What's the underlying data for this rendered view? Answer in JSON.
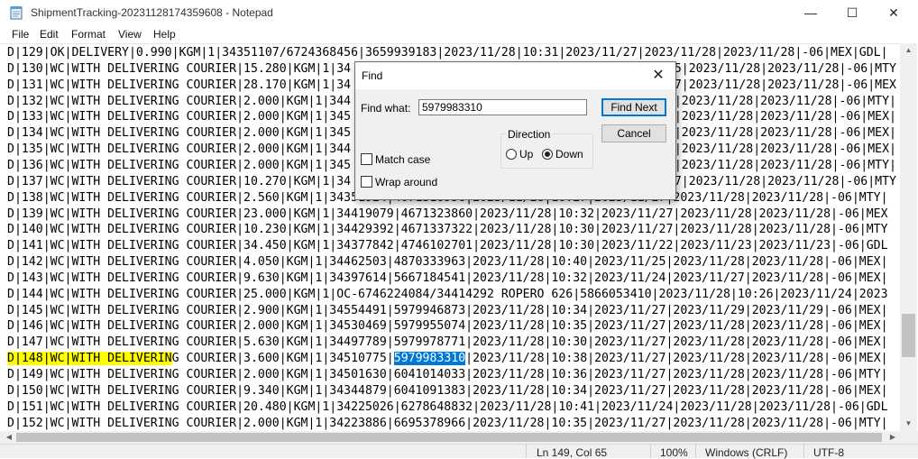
{
  "window": {
    "title": "ShipmentTracking-20231128174359608 - Notepad",
    "minimize_glyph": "—",
    "maximize_glyph": "☐",
    "close_glyph": "✕"
  },
  "menu": [
    "File",
    "Edit",
    "Format",
    "View",
    "Help"
  ],
  "colors": {
    "highlight": "#ffff00",
    "selection": "#0078d7",
    "accent": "#0078d7"
  },
  "editor": {
    "lines": [
      "D|129|OK|DELIVERY|0.990|KGM|1|34351107/6724368456|3659939183|2023/11/28|10:31|2023/11/27|2023/11/28|2023/11/28|-06|MEX|GDL|",
      "D|130|WC|WITH DELIVERING COURIER|15.280|KGM|1|34",
      "D|131|WC|WITH DELIVERING COURIER|28.170|KGM|1|34",
      "D|132|WC|WITH DELIVERING COURIER|2.000|KGM|1|344",
      "D|133|WC|WITH DELIVERING COURIER|2.000|KGM|1|345",
      "D|134|WC|WITH DELIVERING COURIER|2.000|KGM|1|345",
      "D|135|WC|WITH DELIVERING COURIER|2.000|KGM|1|344",
      "D|136|WC|WITH DELIVERING COURIER|2.000|KGM|1|345",
      "D|137|WC|WITH DELIVERING COURIER|10.270|KGM|1|34",
      "D|138|WC|WITH DELIVERING COURIER|2.560|KGM|1|34351924|4671318956|2023/11/28|10:27|2023/11/27|2023/11/28|2023/11/28|-06|MTY|",
      "D|139|WC|WITH DELIVERING COURIER|23.000|KGM|1|34419079|4671323860|2023/11/28|10:32|2023/11/27|2023/11/28|2023/11/28|-06|MEX",
      "D|140|WC|WITH DELIVERING COURIER|10.230|KGM|1|34429392|4671337322|2023/11/28|10:30|2023/11/27|2023/11/28|2023/11/28|-06|MTY",
      "D|141|WC|WITH DELIVERING COURIER|34.450|KGM|1|34377842|4746102701|2023/11/28|10:30|2023/11/22|2023/11/23|2023/11/23|-06|GDL",
      "D|142|WC|WITH DELIVERING COURIER|4.050|KGM|1|34462503|4870333963|2023/11/28|10:40|2023/11/25|2023/11/28|2023/11/28|-06|MEX|",
      "D|143|WC|WITH DELIVERING COURIER|9.630|KGM|1|34397614|5667184541|2023/11/28|10:32|2023/11/24|2023/11/27|2023/11/28|-06|MEX|",
      "D|144|WC|WITH DELIVERING COURIER|25.000|KGM|1|OC-6746224084/34414292 ROPERO 626|5866053410|2023/11/28|10:26|2023/11/24|2023",
      "D|145|WC|WITH DELIVERING COURIER|2.900|KGM|1|34554491|5979946873|2023/11/28|10:34|2023/11/27|2023/11/29|2023/11/29|-06|MEX|",
      "D|146|WC|WITH DELIVERING COURIER|2.000|KGM|1|34530469|5979955074|2023/11/28|10:35|2023/11/27|2023/11/28|2023/11/28|-06|MEX|",
      "D|147|WC|WITH DELIVERING COURIER|5.630|KGM|1|34497789|5979978771|2023/11/28|10:30|2023/11/27|2023/11/28|2023/11/28|-06|MEX|",
      "D|148|WC|WITH DELIVERING COURIER|3.600|KGM|1|34510775|5979983310|2023/11/28|10:38|2023/11/27|2023/11/28|2023/11/28|-06|MEX|",
      "D|149|WC|WITH DELIVERING COURIER|2.000|KGM|1|34501630|6041014033|2023/11/28|10:36|2023/11/27|2023/11/28|2023/11/28|-06|MTY|",
      "D|150|WC|WITH DELIVERING COURIER|9.340|KGM|1|34344879|6041091383|2023/11/28|10:34|2023/11/27|2023/11/28|2023/11/28|-06|MEX|",
      "D|151|WC|WITH DELIVERING COURIER|20.480|KGM|1|34225026|6278648832|2023/11/28|10:41|2023/11/24|2023/11/28|2023/11/28|-06|GDL",
      "D|152|WC|WITH DELIVERING COURIER|2.000|KGM|1|34223886|6695378966|2023/11/28|10:35|2023/11/27|2023/11/28|2023/11/28|-06|MTY|"
    ],
    "right_fragments": [
      "",
      "5|2023/11/28|2023/11/28|-06|MTY",
      "7|2023/11/28|2023/11/28|-06|MEX",
      "|2023/11/28|2023/11/28|-06|MTY|",
      "|2023/11/28|2023/11/28|-06|MEX|",
      "|2023/11/28|2023/11/28|-06|MEX|",
      "|2023/11/28|2023/11/28|-06|MEX|",
      "|2023/11/28|2023/11/28|-06|MTY|",
      "7|2023/11/28|2023/11/28|-06|MTY"
    ],
    "highlighted_line_index": 19,
    "highlight_prefix": "D|148|WC|WITH DELIVERIN",
    "highlight_rest": "G COURIER|3.600|KGM|1|34510775|",
    "selected_text": "5979983310",
    "after_selection": "|2023/11/28|10:38|2023/11/27|2023/11/28|2023/11/28|-06|MEX|"
  },
  "status": {
    "position": "Ln 149, Col 65",
    "zoom": "100%",
    "line_ending": "Windows (CRLF)",
    "encoding": "UTF-8"
  },
  "find_dialog": {
    "title": "Find",
    "find_what_label": "Find what:",
    "find_what_value": "5979983310",
    "find_next_label": "Find Next",
    "cancel_label": "Cancel",
    "direction_label": "Direction",
    "up_label": "Up",
    "down_label": "Down",
    "direction_selected": "Down",
    "match_case_label": "Match case",
    "match_case_checked": false,
    "wrap_around_label": "Wrap around",
    "wrap_around_checked": false
  }
}
